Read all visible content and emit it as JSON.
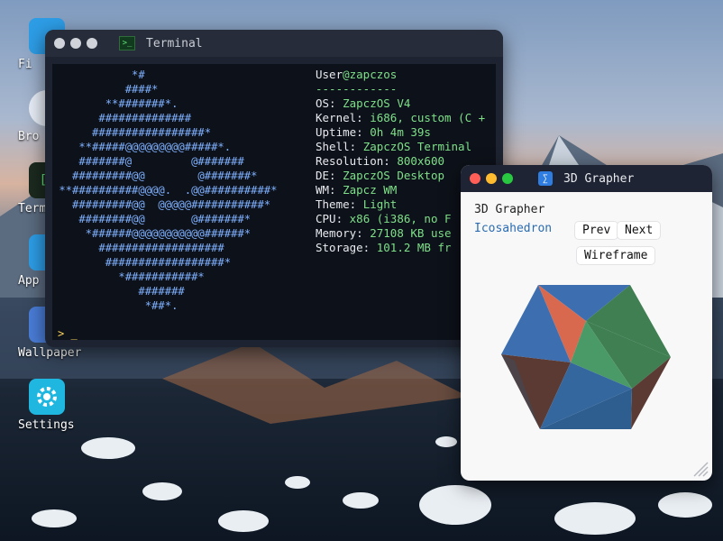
{
  "desktop": {
    "icons": [
      {
        "label": "Fi",
        "color": "#2d9de6"
      },
      {
        "label": "Bro",
        "color": "#e8eef8"
      },
      {
        "label": "Term",
        "color": "#1b2a1f"
      },
      {
        "label": "App",
        "color": "#2d9de6"
      },
      {
        "label": "Wallpaper",
        "color": "#4a7dd8"
      },
      {
        "label": "Settings",
        "color": "#1fb6e0"
      }
    ]
  },
  "terminal": {
    "title": "Terminal",
    "ascii_art": "            *#\n           ####*\n        **#######*.\n       ##############\n      #################*\n    **#####@@@@@@@@@#####*.\n    #######@         @#######\n   #########@@        @#######*\n **##########@@@@.  .@@##########*\n   #########@@  @@@@@###########*\n    ########@@       @#######*\n     *######@@@@@@@@@@@######*\n       ###################\n        ##################*\n          *###########*\n             #######\n              *##*.",
    "user": "User",
    "host": "@zapczos",
    "separator": "------------",
    "info": [
      {
        "key": "OS:",
        "value": "ZapczOS V4"
      },
      {
        "key": "Kernel:",
        "value": "i686, custom (C +"
      },
      {
        "key": "Uptime:",
        "value": "0h 4m 39s"
      },
      {
        "key": "Shell:",
        "value": "ZapczOS Terminal"
      },
      {
        "key": "Resolution:",
        "value": "800x600"
      },
      {
        "key": "DE:",
        "value": "ZapczOS Desktop"
      },
      {
        "key": "WM:",
        "value": "Zapcz WM"
      },
      {
        "key": "Theme:",
        "value": "Light"
      },
      {
        "key": "CPU:",
        "value": "x86 (i386, no F"
      },
      {
        "key": "Memory:",
        "value": "27108 KB use"
      },
      {
        "key": "Storage:",
        "value": "101.2 MB fr"
      }
    ],
    "prompt": "> _"
  },
  "grapher": {
    "title": "3D Grapher",
    "heading": "3D Grapher",
    "shape": "Icosahedron",
    "prev_label": "Prev",
    "next_label": "Next",
    "mode_label": "Wireframe"
  },
  "colors": {
    "window_close": "#ff5f57",
    "window_min": "#febc2e",
    "window_max": "#28c840",
    "terminal_dot": "#d0d3d9",
    "accent_blue": "#2b6cb0",
    "terminal_green": "#7fe08a",
    "ascii_blue": "#7fb1ff"
  }
}
